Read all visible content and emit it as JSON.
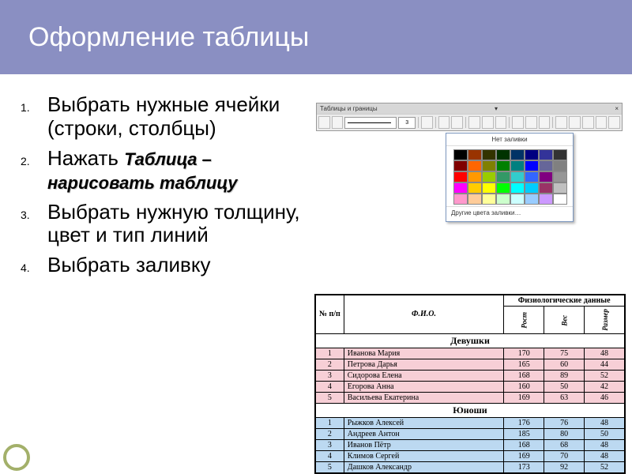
{
  "slide": {
    "title": "Оформление таблицы",
    "items": [
      {
        "text": "Выбрать нужные ячейки (строки, столбцы)"
      },
      {
        "prefix": "Нажать ",
        "emph": "Таблица – нарисовать таблицу"
      },
      {
        "text": "Выбрать нужную толщину, цвет и тип линий"
      },
      {
        "text": "Выбрать заливку"
      }
    ]
  },
  "toolbar": {
    "title": "Таблицы и границы",
    "lineWidth": "3",
    "close": "×",
    "handle": "▾"
  },
  "fillDropdown": {
    "noFill": "Нет заливки",
    "moreColors": "Другие цвета заливки…",
    "rows": [
      [
        "#000000",
        "#993300",
        "#333300",
        "#003300",
        "#003366",
        "#000080",
        "#333399",
        "#333333"
      ],
      [
        "#800000",
        "#ff6600",
        "#808000",
        "#008000",
        "#008080",
        "#0000ff",
        "#666699",
        "#808080"
      ],
      [
        "#ff0000",
        "#ff9900",
        "#99cc00",
        "#339966",
        "#33cccc",
        "#3366ff",
        "#800080",
        "#969696"
      ],
      [
        "#ff00ff",
        "#ffcc00",
        "#ffff00",
        "#00ff00",
        "#00ffff",
        "#00ccff",
        "#993366",
        "#c0c0c0"
      ],
      [
        "#ff99cc",
        "#ffcc99",
        "#ffff99",
        "#ccffcc",
        "#ccffff",
        "#99ccff",
        "#cc99ff",
        "#ffffff"
      ]
    ]
  },
  "table": {
    "headers": {
      "num": "№ п/п",
      "fio": "Ф.И.О.",
      "super": "Физиологические данные",
      "rost": "Рост",
      "ves": "Вес",
      "razmer": "Размер"
    },
    "sections": [
      {
        "title": "Девушки",
        "style": "pink",
        "rows": [
          {
            "n": "1",
            "fio": "Иванова Мария",
            "rost": "170",
            "ves": "75",
            "raz": "48"
          },
          {
            "n": "2",
            "fio": "Петрова Дарья",
            "rost": "165",
            "ves": "60",
            "raz": "44"
          },
          {
            "n": "3",
            "fio": "Сидорова Елена",
            "rost": "168",
            "ves": "89",
            "raz": "52"
          },
          {
            "n": "4",
            "fio": "Егорова Анна",
            "rost": "160",
            "ves": "50",
            "raz": "42"
          },
          {
            "n": "5",
            "fio": "Васильева Екатерина",
            "rost": "169",
            "ves": "63",
            "raz": "46"
          }
        ]
      },
      {
        "title": "Юноши",
        "style": "blue",
        "rows": [
          {
            "n": "1",
            "fio": "Рыжков Алексей",
            "rost": "176",
            "ves": "76",
            "raz": "48"
          },
          {
            "n": "2",
            "fio": "Андреев Антон",
            "rost": "185",
            "ves": "80",
            "raz": "50"
          },
          {
            "n": "3",
            "fio": "Иванов Пётр",
            "rost": "168",
            "ves": "68",
            "raz": "48"
          },
          {
            "n": "4",
            "fio": "Климов Сергей",
            "rost": "169",
            "ves": "70",
            "raz": "48"
          },
          {
            "n": "5",
            "fio": "Дашков Александр",
            "rost": "173",
            "ves": "92",
            "raz": "52"
          }
        ]
      }
    ]
  }
}
